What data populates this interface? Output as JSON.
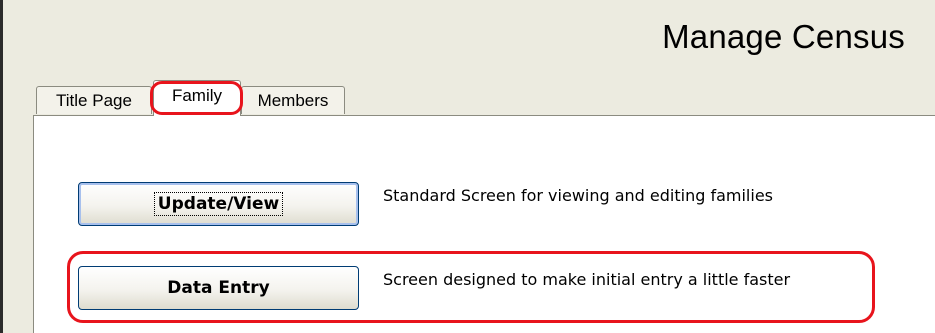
{
  "window": {
    "title": "Manage Census"
  },
  "tabs": [
    {
      "label": "Title Page",
      "active": false
    },
    {
      "label": "Family",
      "active": true
    },
    {
      "label": "Members",
      "active": false
    }
  ],
  "actions": [
    {
      "button_label": "Update/View",
      "description": "Standard Screen for viewing and editing families",
      "focused": true
    },
    {
      "button_label": "Data Entry",
      "description": "Screen designed to make initial entry a little faster",
      "focused": false
    }
  ],
  "annotations": {
    "highlight_color": "#e8141c",
    "highlighted": [
      "Family tab",
      "Data Entry row"
    ]
  },
  "colors": {
    "window_background": "#ecebe0",
    "panel_background": "#ffffff",
    "button_border": "#003c74"
  }
}
